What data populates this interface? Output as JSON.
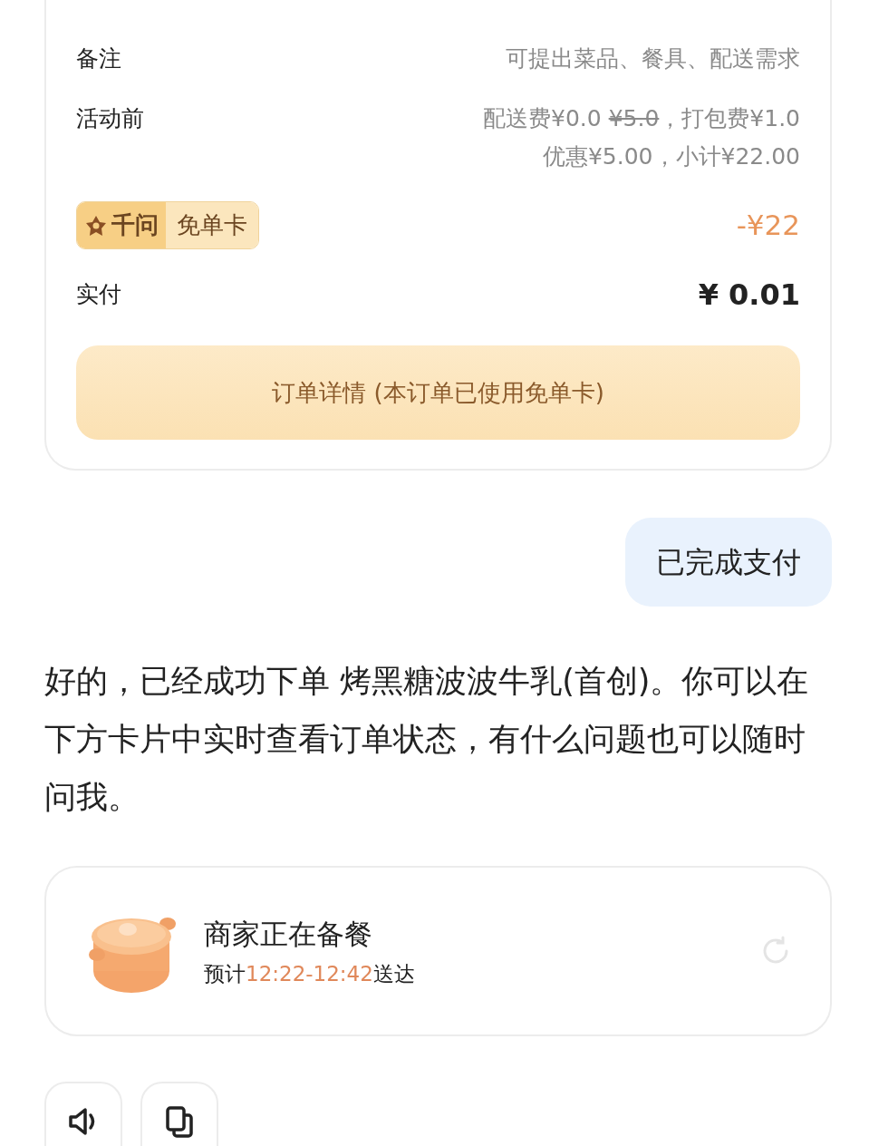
{
  "order_card": {
    "rows": [
      {
        "label": "备注",
        "value": "可提出菜品、餐具、配送需求"
      }
    ],
    "pre_activity": {
      "label": "活动前",
      "lines": [
        [
          {
            "text": "配送费¥0.0 ",
            "struck": false
          },
          {
            "text": "¥5.0",
            "struck": true
          },
          {
            "text": "，打包费¥1.0",
            "struck": false
          }
        ],
        [
          {
            "text": "优惠¥5.00，小计¥22.00",
            "struck": false
          }
        ]
      ]
    },
    "voucher": {
      "brand": "千问",
      "label": "免单卡",
      "amount": "-¥22"
    },
    "paid": {
      "label": "实付",
      "amount": "¥ 0.01"
    },
    "details_button": "订单详情 (本订单已使用免单卡)"
  },
  "user_message": "已完成支付",
  "assistant_message": "好的，已经成功下单 烤黑糖波波牛乳(首创)。你可以在下方卡片中实时查看订单状态，有什么问题也可以随时问我。",
  "status_card": {
    "title": "商家正在备餐",
    "eta_prefix": "预计",
    "eta_time": "12:22-12:42",
    "eta_suffix": "送达"
  },
  "actions": [
    {
      "kind": "speaker"
    },
    {
      "kind": "copy"
    }
  ]
}
